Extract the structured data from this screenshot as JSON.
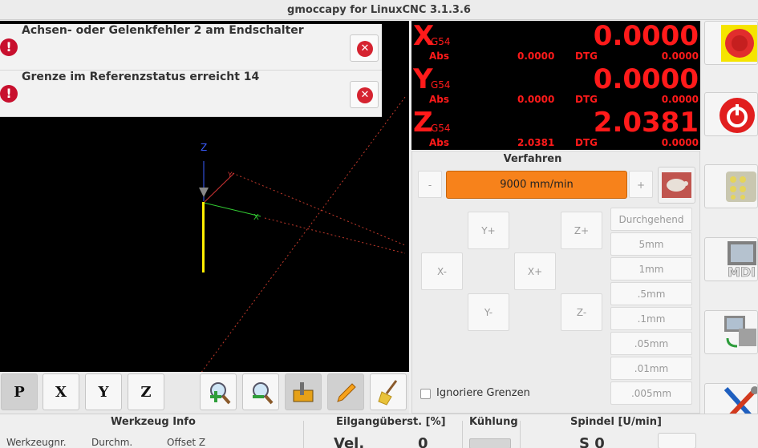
{
  "window": {
    "title": "gmoccapy for LinuxCNC  3.1.3.6"
  },
  "messages": [
    {
      "text": "Achsen- oder Gelenkfehler 2 am Endschalter"
    },
    {
      "text": "Grenze im Referenzstatus erreicht 14"
    }
  ],
  "preview": {
    "axis_labels": {
      "z": "Z",
      "x": "X",
      "y": "Y"
    }
  },
  "preview_toolbar": {
    "buttons": [
      {
        "label": "P",
        "icon": "view-p-icon"
      },
      {
        "label": "X",
        "icon": "view-x-icon"
      },
      {
        "label": "Y",
        "icon": "view-y-icon"
      },
      {
        "label": "Z",
        "icon": "view-z-icon"
      },
      {
        "icon": "zoom-in-icon"
      },
      {
        "icon": "zoom-out-icon"
      },
      {
        "icon": "measure-icon"
      },
      {
        "icon": "pencil-icon"
      },
      {
        "icon": "broom-icon"
      }
    ]
  },
  "dro": {
    "rows": [
      {
        "axis": "X",
        "coord": "G54",
        "abs_label": "Abs",
        "value": "0.0000",
        "abs": "0.0000",
        "dtg_label": "DTG",
        "dtg": "0.0000"
      },
      {
        "axis": "Y",
        "coord": "G54",
        "abs_label": "Abs",
        "value": "0.0000",
        "abs": "0.0000",
        "dtg_label": "DTG",
        "dtg": "0.0000"
      },
      {
        "axis": "Z",
        "coord": "G54",
        "abs_label": "Abs",
        "value": "2.0381",
        "abs": "2.0381",
        "dtg_label": "DTG",
        "dtg": "0.0000"
      }
    ],
    "color": "#ff1a1a"
  },
  "jog": {
    "title": "Verfahren",
    "minus": "-",
    "plus": "+",
    "speed": "9000 mm/min",
    "buttons": {
      "y_plus": "Y+",
      "y_minus": "Y-",
      "x_minus": "X-",
      "x_plus": "X+",
      "z_plus": "Z+",
      "z_minus": "Z-"
    },
    "increments": [
      "Durchgehend",
      "5mm",
      "1mm",
      ".5mm",
      ".1mm",
      ".05mm",
      ".01mm",
      ".005mm"
    ],
    "ignore_limits": "Ignoriere Grenzen",
    "accent": "#f7821b"
  },
  "right_buttons": [
    {
      "icon": "emergency-stop-icon"
    },
    {
      "icon": "power-icon"
    },
    {
      "icon": "manual-mode-icon"
    },
    {
      "icon": "mdi-icon",
      "label": "MDI"
    },
    {
      "icon": "auto-mode-icon"
    },
    {
      "icon": "settings-tools-icon"
    }
  ],
  "bottom": {
    "tool_info": {
      "title": "Werkzeug Info",
      "cols": [
        "Werkzeugnr.",
        "Durchm.",
        "Offset Z"
      ]
    },
    "rapid": {
      "title": "Eilgangüberst. [%]",
      "label": "Vel.",
      "value": "0"
    },
    "coolant": {
      "title": "Kühlung"
    },
    "spindle": {
      "title": "Spindel [U/min]",
      "value": "S 0"
    }
  }
}
